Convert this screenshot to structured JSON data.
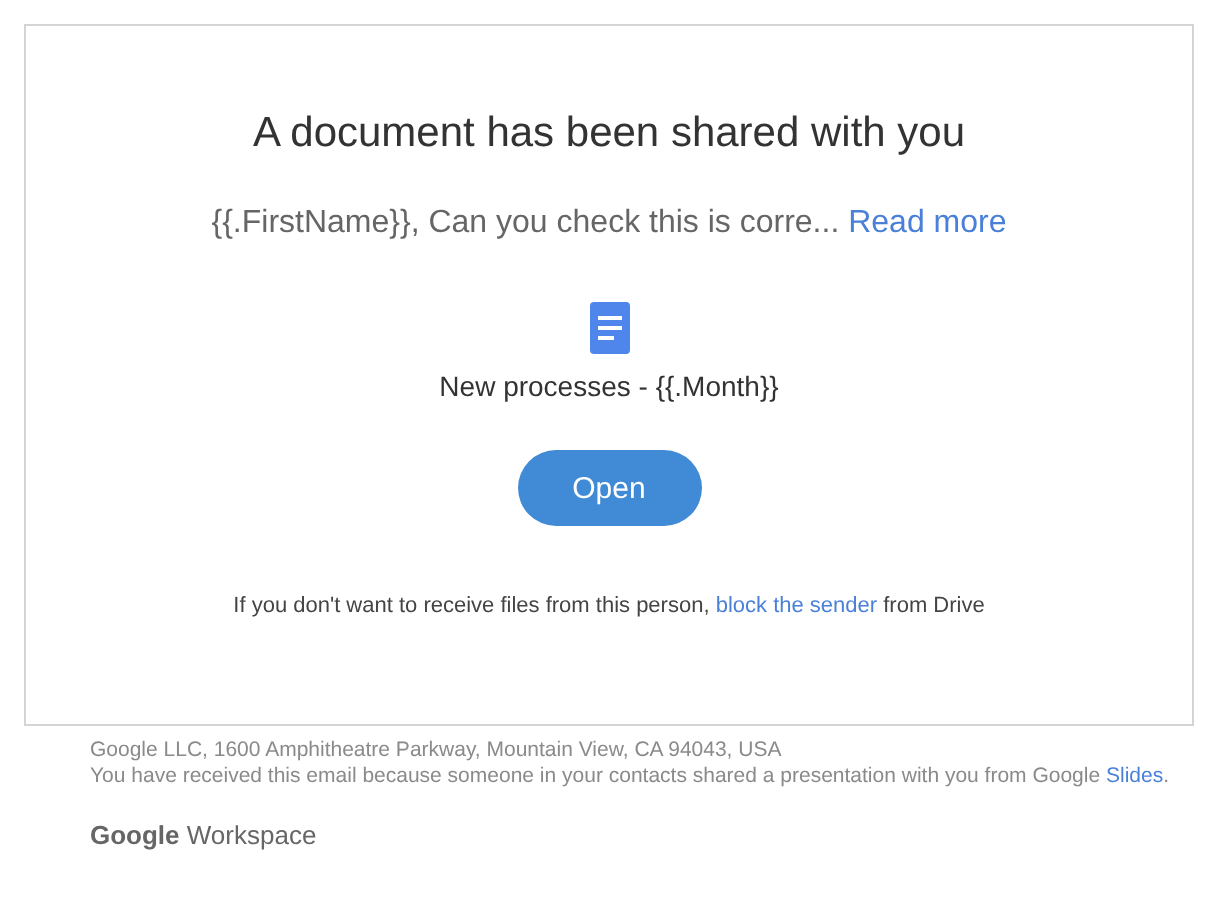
{
  "email": {
    "title": "A document has been shared with you",
    "message": {
      "text": "{{.FirstName}}, Can you check this is corre...",
      "link": "Read more"
    },
    "document": {
      "name": "New processes - {{.Month}}"
    },
    "open_button": "Open",
    "notice": {
      "before": "If you don't want to receive files from this person,",
      "link": "block the sender",
      "after": "from Drive"
    }
  },
  "footer": {
    "address": "Google LLC, 1600 Amphitheatre Parkway, Mountain View, CA 94043, USA",
    "disclaimer": {
      "before": "You have received this email because someone in your contacts shared a presentation with you from Google",
      "link": "Slides",
      "after": "."
    },
    "brand": "**Google** Workspace"
  }
}
